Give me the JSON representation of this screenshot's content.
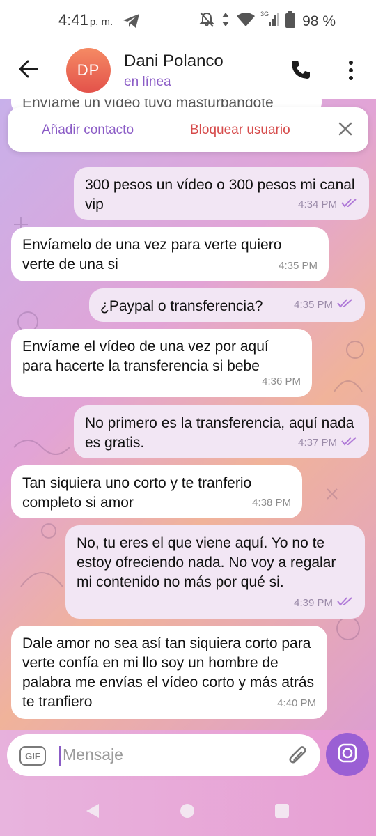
{
  "status_bar": {
    "time": "4:41",
    "ampm": "p. m.",
    "network": "3G",
    "battery": "98 %",
    "battery_level": 0.98,
    "icons": [
      "telegram-icon",
      "bell-off-icon",
      "data-arrows-icon",
      "wifi-icon",
      "signal-icon",
      "battery-icon"
    ]
  },
  "header": {
    "avatar_initials": "DP",
    "name": "Dani Polanco",
    "status": "en línea",
    "icons": [
      "back-arrow-icon",
      "phone-icon",
      "more-vertical-icon"
    ]
  },
  "banner": {
    "add_contact": "Añadir contacto",
    "block_user": "Bloquear usuario"
  },
  "peek_message": "Envíame un vídeo tuyo masturbándote",
  "messages": [
    {
      "dir": "out",
      "text": "300 pesos un vídeo o 300 pesos mi canal vip",
      "time": "4:34 PM"
    },
    {
      "dir": "in",
      "text": "Envíamelo de una vez para verte quiero verte de una si",
      "time": "4:35 PM"
    },
    {
      "dir": "out",
      "text": "¿Paypal o transferencia?",
      "time": "4:35 PM"
    },
    {
      "dir": "in",
      "text": "Envíame el vídeo de una vez por aquí para hacerte la transferencia si bebe",
      "time": "4:36 PM"
    },
    {
      "dir": "out",
      "text": "No primero es la transferencia, aquí nada es gratis.",
      "time": "4:37 PM"
    },
    {
      "dir": "in",
      "text": "Tan siquiera uno corto y te tranferio completo si amor",
      "time": "4:38 PM"
    },
    {
      "dir": "out",
      "text": "No, tu eres el que viene aquí. Yo no te estoy ofreciendo nada. No voy a regalar mi contenido no más por qué si.",
      "time": "4:39 PM"
    },
    {
      "dir": "in",
      "text": "Dale amor no sea así tan siquiera corto para verte confía en mi llo soy un hombre de palabra me envías el vídeo corto y más atrás te tranfiero",
      "time": "4:40 PM"
    }
  ],
  "composer": {
    "gif_label": "GIF",
    "placeholder": "Mensaje"
  },
  "colors": {
    "accent": "#8b5cc6",
    "danger": "#d64a4a",
    "outgoing_bubble": "#f2e6f4",
    "incoming_bubble": "#ffffff",
    "read_check": "#b07ad8"
  }
}
